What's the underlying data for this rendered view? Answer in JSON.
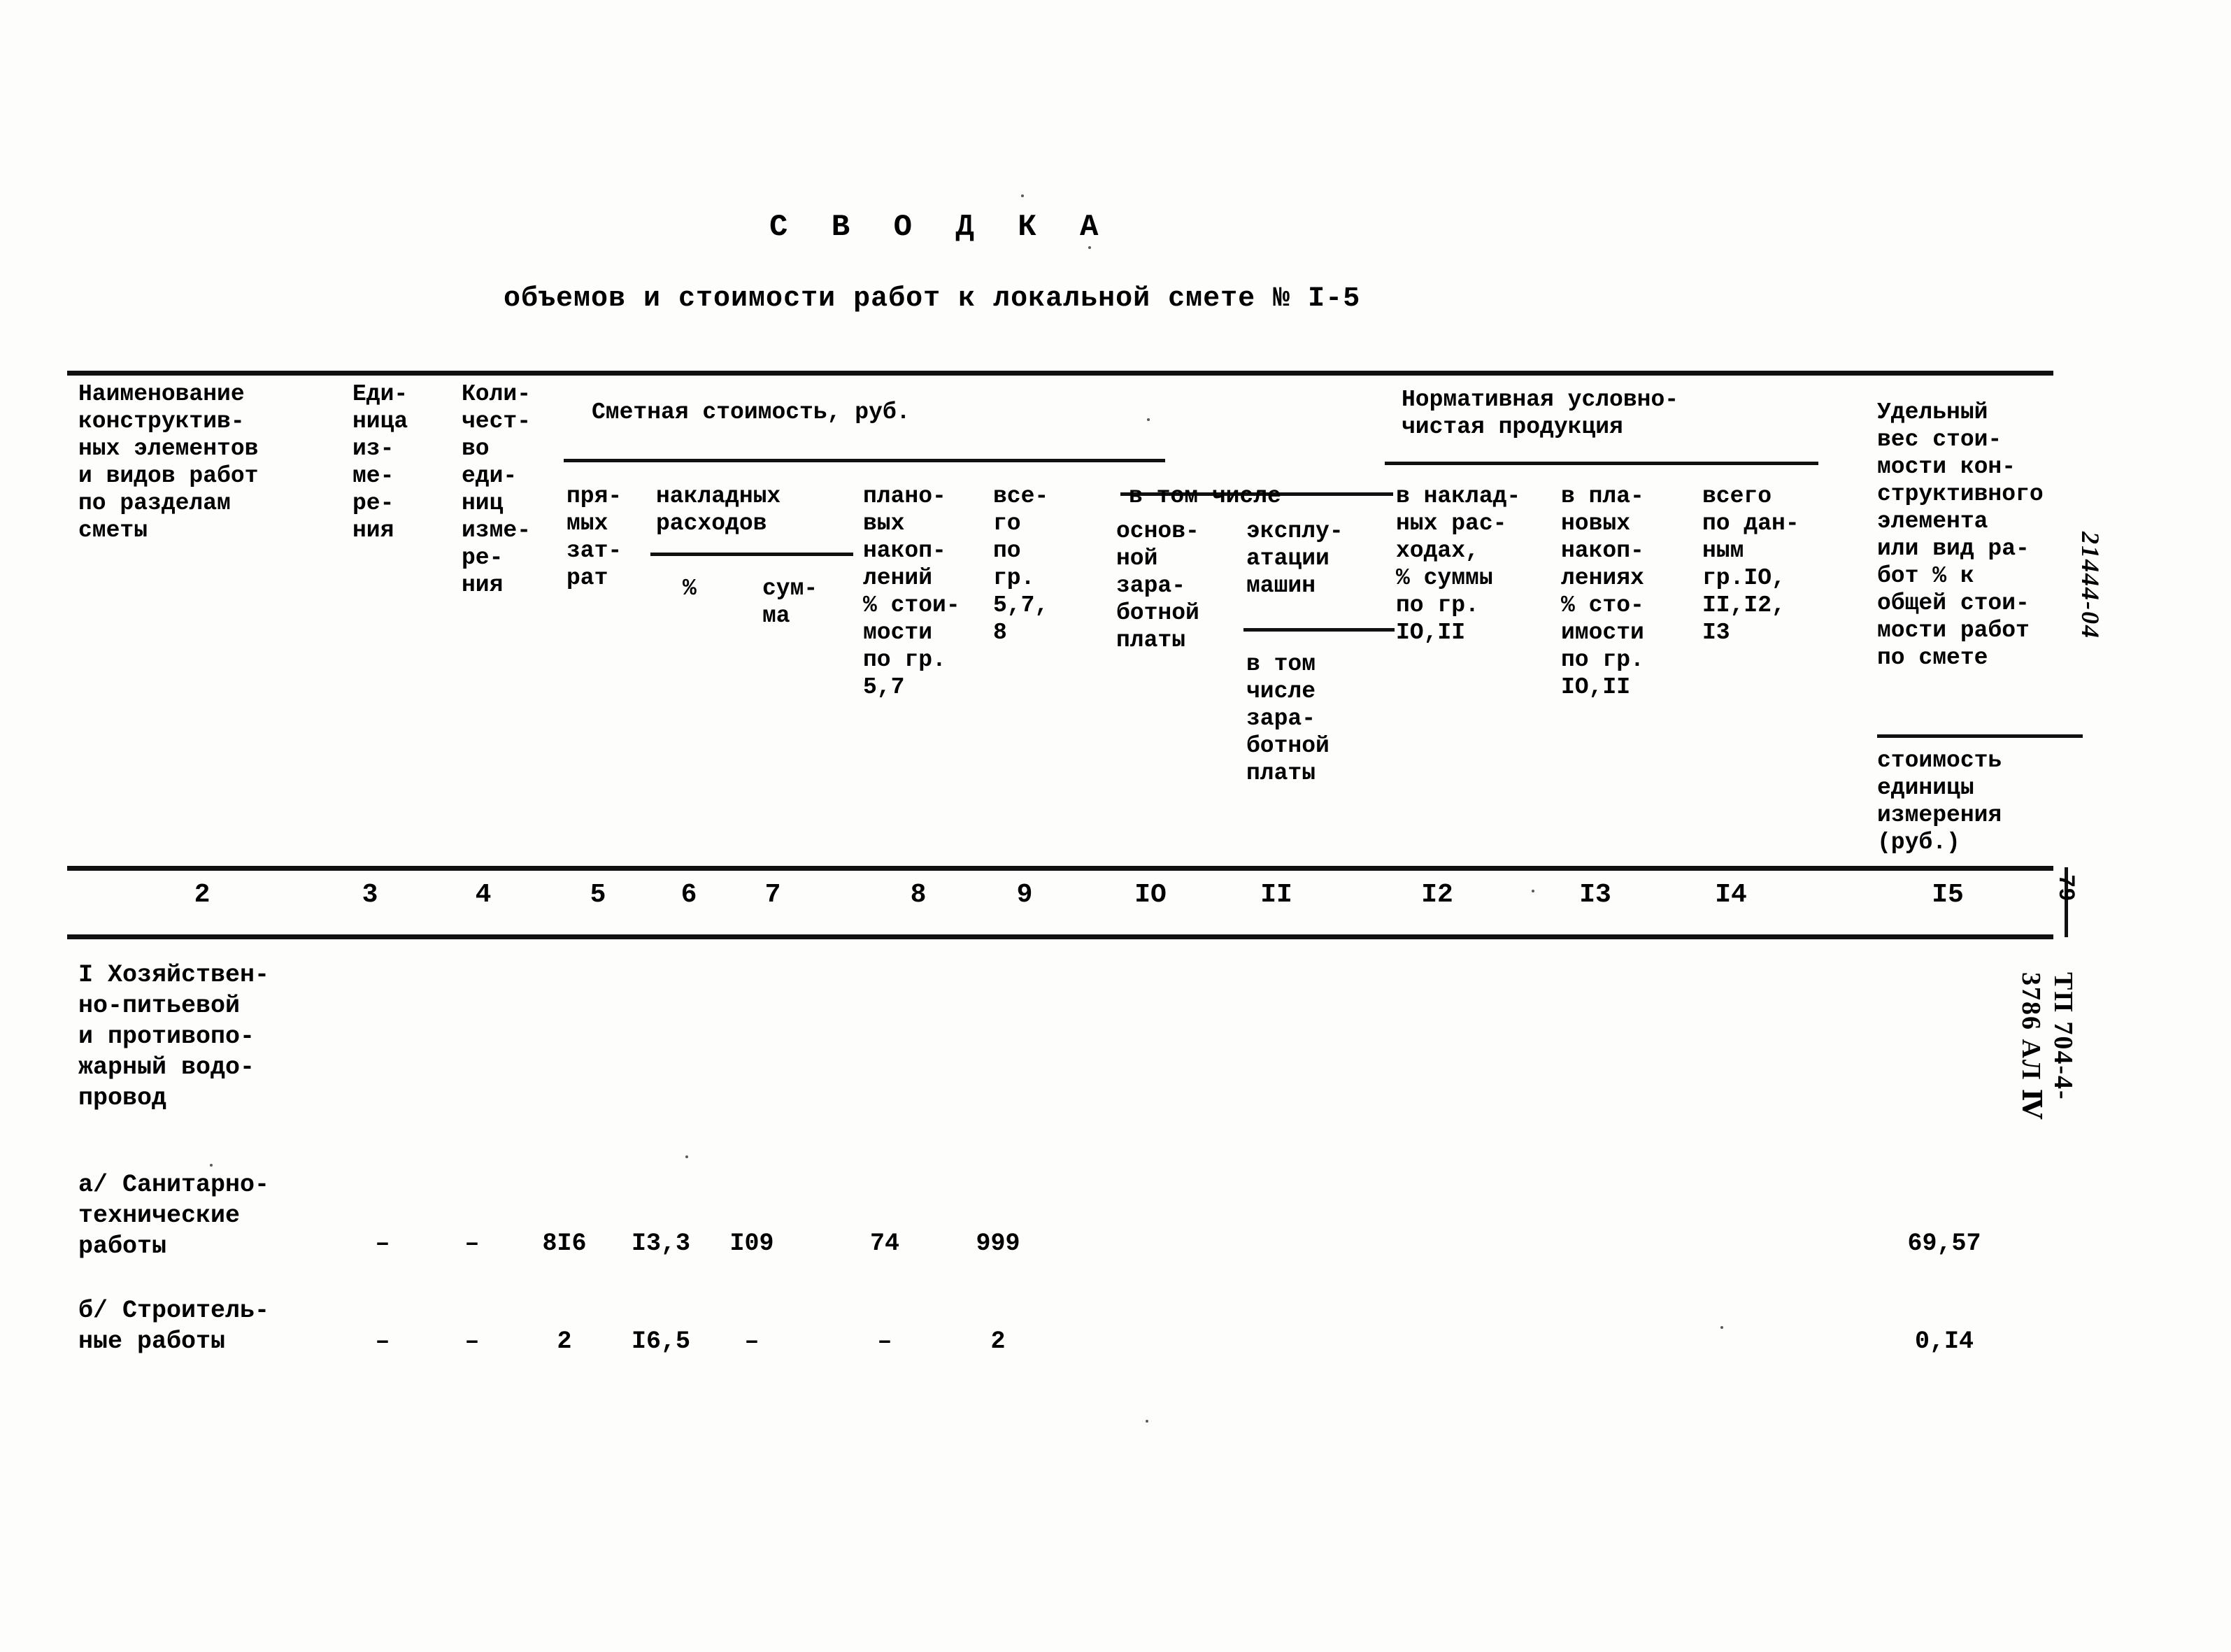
{
  "document": {
    "title": "С В О Д К А",
    "subtitle": "объемов и стоимости работ к локальной смете № I-5",
    "page_number": "79",
    "archive_code": "ТП 704-4-3786   АЛ Ⅳ",
    "hand_annotation": "21444-04"
  },
  "table": {
    "headers": {
      "col2": "Наименование\nконструктив-\nных элементов\nи видов работ\nпо разделам\nсметы",
      "col3": "Еди-\nница\nиз-\nме-\nре-\nния",
      "col4": "Коли-\nчест-\nво\nеди-\nниц\nизме-\nре-\nния",
      "group_smetnaya": "Сметная стоимость, руб.",
      "col5": "пря-\nмых\nзат-\nрат",
      "group_nakladnyh": "накладных\nрасходов",
      "col6": "%",
      "col7": "сум-\nма",
      "col8": "плано-\nвых\nнакоп-\nлений\n% стои-\nмости\nпо гр.\n5,7",
      "col9": "все-\nго\nпо\nгр.\n5,7,\n8",
      "group_vtomchisle": "в том числе",
      "col10": "основ-\nной\nзара-\nботной\nплаты",
      "col11a": "эксплу-\nатации\nмашин",
      "col11b": "в том\nчисле\nзара-\nботной\nплаты",
      "group_nchp": "Нормативная условно-\nчистая продукция",
      "col12": "в наклад-\nных рас-\nходах,\n% суммы\nпо гр.\nIO,II",
      "col13": "в пла-\nновых\nнакоп-\nлениях\n% сто-\nимости\nпо гр.\nIO,II",
      "col14": "всего\nпо дан-\nным\nгр.IO,\nII,I2,\nI3",
      "col15": "Удельный\nвес стои-\nмости кон-\nструктивного\nэлемента\nили вид ра-\nбот %  к\nобщей стои-\nмости работ\nпо смете",
      "col15b": "стоимость\nединицы\nизмерения\n(руб.)"
    },
    "column_numbers": [
      "2",
      "3",
      "4",
      "5",
      "6",
      "7",
      "8",
      "9",
      "IO",
      "II",
      "I2",
      "I3",
      "I4",
      "I5"
    ],
    "rows": [
      {
        "name": "I Хозяйствен-\n  но-питьевой\n  и противопо-\n  жарный водо-\n  провод",
        "values": [
          "",
          "",
          "",
          "",
          "",
          "",
          "",
          "",
          "",
          "",
          "",
          "",
          ""
        ]
      },
      {
        "name": "а/ Санитарно-\n   технические\n   работы",
        "values": [
          "–",
          "–",
          "8I6",
          "I3,3",
          "I09",
          "74",
          "999",
          "",
          "",
          "",
          "",
          "",
          "69,57"
        ]
      },
      {
        "name": "б/ Строитель-\n   ные работы",
        "values": [
          "–",
          "–",
          "2",
          "I6,5",
          "–",
          "–",
          "2",
          "",
          "",
          "",
          "",
          "",
          "0,I4"
        ]
      }
    ]
  }
}
